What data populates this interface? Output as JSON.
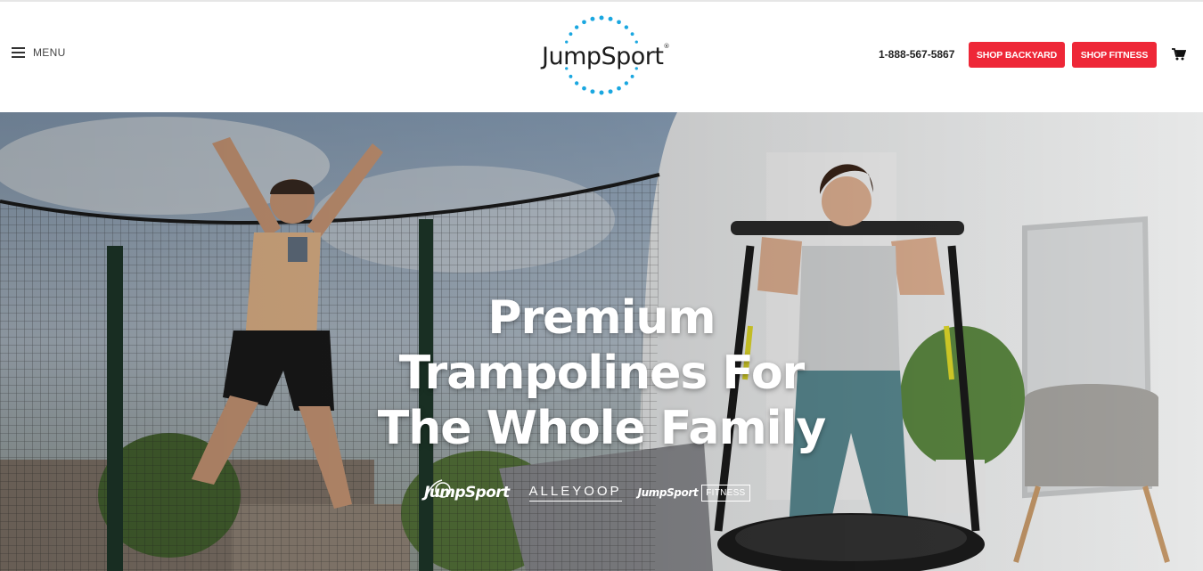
{
  "header": {
    "menu_label": "MENU",
    "logo_text": "JumpSport",
    "logo_mark": "®",
    "phone": "1-888-567-5867",
    "shop_backyard_label": "SHOP BACKYARD",
    "shop_fitness_label": "SHOP FITNESS",
    "cart_icon": "shopping-cart-icon",
    "accent_color": "#ee2737",
    "logo_dot_color": "#1aa7e0"
  },
  "hero": {
    "headline_line1": "Premium",
    "headline_line2": "Trampolines For",
    "headline_line3": "The Whole Family",
    "brands": {
      "jumpsport": "JumpSport",
      "alleyoop": "ALLEYOOP",
      "jumpsport_fitness_name": "JumpSport",
      "fitness": "FITNESS"
    }
  }
}
